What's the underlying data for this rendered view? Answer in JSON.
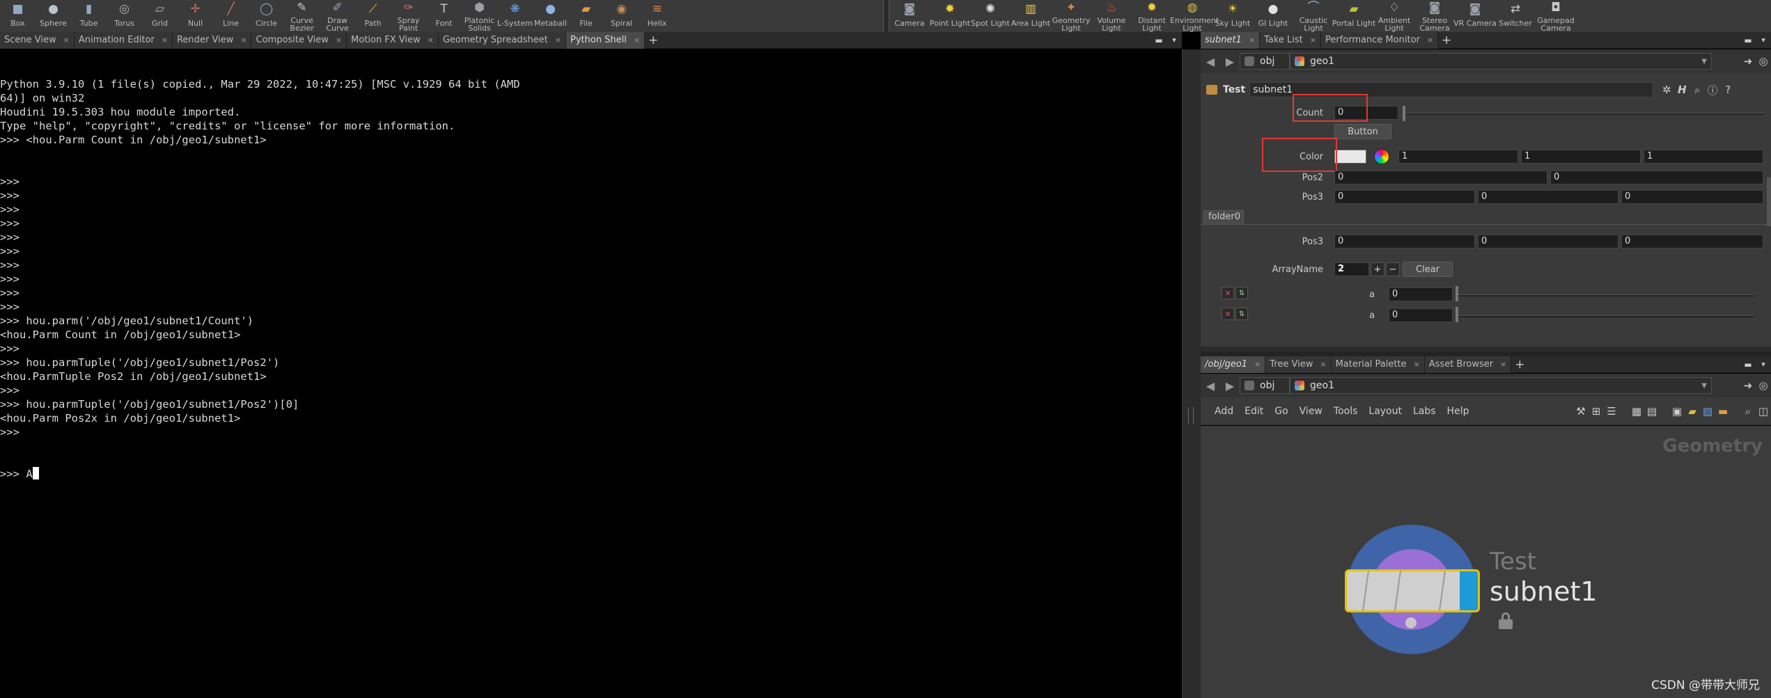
{
  "shelf_left": [
    {
      "label": "Box",
      "icon": "box-icon",
      "glyph": "■",
      "color": "#8fa8c4"
    },
    {
      "label": "Sphere",
      "icon": "sphere-icon",
      "glyph": "●",
      "color": "#b9c4d0"
    },
    {
      "label": "Tube",
      "icon": "tube-icon",
      "glyph": "▮",
      "color": "#8fa8c4"
    },
    {
      "label": "Torus",
      "icon": "torus-icon",
      "glyph": "◎",
      "color": "#a9b6c6"
    },
    {
      "label": "Grid",
      "icon": "grid-icon",
      "glyph": "▱",
      "color": "#a9b6c6"
    },
    {
      "label": "Null",
      "icon": "null-icon",
      "glyph": "✛",
      "color": "#d0705a"
    },
    {
      "label": "Line",
      "icon": "line-icon",
      "glyph": "╱",
      "color": "#d0705a"
    },
    {
      "label": "Circle",
      "icon": "circle-icon",
      "glyph": "◯",
      "color": "#8fa8c4"
    },
    {
      "label": "Curve Bezier",
      "icon": "curve-bezier-icon",
      "glyph": "✎",
      "color": "#c9c9c9"
    },
    {
      "label": "Draw Curve",
      "icon": "draw-curve-icon",
      "glyph": "✐",
      "color": "#8fa8c4"
    },
    {
      "label": "Path",
      "icon": "path-icon",
      "glyph": "⟋",
      "color": "#e0c040"
    },
    {
      "label": "Spray Paint",
      "icon": "spray-paint-icon",
      "glyph": "✑",
      "color": "#d07070"
    },
    {
      "label": "Font",
      "icon": "font-icon",
      "glyph": "T",
      "color": "#c9c9c9"
    },
    {
      "label": "Platonic Solids",
      "icon": "platonic-solids-icon",
      "glyph": "⬢",
      "color": "#9aa0a8"
    },
    {
      "label": "L-System",
      "icon": "l-system-icon",
      "glyph": "❋",
      "color": "#6aa0e0"
    },
    {
      "label": "Metaball",
      "icon": "metaball-icon",
      "glyph": "●",
      "color": "#8fb4e0"
    },
    {
      "label": "File",
      "icon": "file-icon",
      "glyph": "▰",
      "color": "#e0a040"
    },
    {
      "label": "Spiral",
      "icon": "spiral-icon",
      "glyph": "◉",
      "color": "#d08a50"
    },
    {
      "label": "Helix",
      "icon": "helix-icon",
      "glyph": "≋",
      "color": "#d08a50"
    }
  ],
  "shelf_right": [
    {
      "label": "Camera",
      "icon": "camera-icon",
      "glyph": "◙",
      "color": "#9aa0a8"
    },
    {
      "label": "Point Light",
      "icon": "point-light-icon",
      "glyph": "✸",
      "color": "#f0d040"
    },
    {
      "label": "Spot Light",
      "icon": "spot-light-icon",
      "glyph": "✺",
      "color": "#e0e0e0"
    },
    {
      "label": "Area Light",
      "icon": "area-light-icon",
      "glyph": "▥",
      "color": "#f0d040"
    },
    {
      "label": "Geometry Light",
      "icon": "geometry-light-icon",
      "glyph": "✦",
      "color": "#d08a50"
    },
    {
      "label": "Volume Light",
      "icon": "volume-light-icon",
      "glyph": "♨",
      "color": "#e06030"
    },
    {
      "label": "Distant Light",
      "icon": "distant-light-icon",
      "glyph": "✹",
      "color": "#f0d040"
    },
    {
      "label": "Environment Light",
      "icon": "environment-light-icon",
      "glyph": "◍",
      "color": "#e0c040"
    },
    {
      "label": "Sky Light",
      "icon": "sky-light-icon",
      "glyph": "☀",
      "color": "#f0d040"
    },
    {
      "label": "GI Light",
      "icon": "gi-light-icon",
      "glyph": "●",
      "color": "#e0e0e0"
    },
    {
      "label": "Caustic Light",
      "icon": "caustic-light-icon",
      "glyph": "⌒",
      "color": "#8fb4e0"
    },
    {
      "label": "Portal Light",
      "icon": "portal-light-icon",
      "glyph": "▰",
      "color": "#c0c040"
    },
    {
      "label": "Ambient Light",
      "icon": "ambient-light-icon",
      "glyph": "♢",
      "color": "#e0e0e0"
    },
    {
      "label": "Stereo Camera",
      "icon": "stereo-camera-icon",
      "glyph": "◙",
      "color": "#9aa0a8"
    },
    {
      "label": "VR Camera",
      "icon": "vr-camera-icon",
      "glyph": "◙",
      "color": "#9aa0a8"
    },
    {
      "label": "Switcher",
      "icon": "switcher-icon",
      "glyph": "⇄",
      "color": "#c9c9c9"
    },
    {
      "label": "Gamepad Camera",
      "icon": "gamepad-camera-icon",
      "glyph": "◘",
      "color": "#c9c9c9"
    }
  ],
  "left_tabs": [
    {
      "label": "Scene View",
      "active": false
    },
    {
      "label": "Animation Editor",
      "active": false
    },
    {
      "label": "Render View",
      "active": false
    },
    {
      "label": "Composite View",
      "active": false
    },
    {
      "label": "Motion FX View",
      "active": false
    },
    {
      "label": "Geometry Spreadsheet",
      "active": false
    },
    {
      "label": "Python Shell",
      "active": true
    }
  ],
  "console_lines": [
    "Python 3.9.10 (1 file(s) copied., Mar 29 2022, 10:47:25) [MSC v.1929 64 bit (AMD",
    "64)] on win32",
    "Houdini 19.5.303 hou module imported.",
    "Type \"help\", \"copyright\", \"credits\" or \"license\" for more information.",
    ">>> <hou.Parm Count in /obj/geo1/subnet1>",
    "",
    "",
    ">>>",
    ">>>",
    ">>>",
    ">>>",
    ">>>",
    ">>>",
    ">>>",
    ">>>",
    ">>>",
    ">>>",
    ">>> hou.parm('/obj/geo1/subnet1/Count')",
    "<hou.Parm Count in /obj/geo1/subnet1>",
    ">>>",
    ">>> hou.parmTuple('/obj/geo1/subnet1/Pos2')",
    "<hou.ParmTuple Pos2 in /obj/geo1/subnet1>",
    ">>>",
    ">>> hou.parmTuple('/obj/geo1/subnet1/Pos2')[0]",
    "<hou.Parm Pos2x in /obj/geo1/subnet1>",
    ">>>"
  ],
  "console_prompt": ">>> A",
  "param_tabs": [
    {
      "label": "subnet1",
      "active": true,
      "italic": true
    },
    {
      "label": "Take List",
      "active": false,
      "italic": false
    },
    {
      "label": "Performance Monitor",
      "active": false,
      "italic": false
    }
  ],
  "param_path": {
    "context": "obj",
    "node": "geo1"
  },
  "param_header": {
    "type": "Test",
    "name": "subnet1"
  },
  "params": {
    "count_label": "Count",
    "count_value": "0",
    "button_label": "Button",
    "color_label": "Color",
    "color_r": "1",
    "color_g": "1",
    "color_b": "1",
    "pos2_label": "Pos2",
    "pos2_x": "0",
    "pos2_y": "0",
    "pos3_label": "Pos3",
    "pos3_x": "0",
    "pos3_y": "0",
    "pos3_z": "0",
    "folder_label": "folder0",
    "pos3b_label": "Pos3",
    "pos3b_x": "0",
    "pos3b_y": "0",
    "pos3b_z": "0",
    "array_label": "ArrayName",
    "array_value": "2",
    "clear_label": "Clear",
    "a1_label": "a",
    "a1_value": "0",
    "a2_label": "a",
    "a2_value": "0"
  },
  "net_tabs": [
    {
      "label": "/obj/geo1",
      "active": true,
      "italic": true
    },
    {
      "label": "Tree View",
      "active": false,
      "italic": false
    },
    {
      "label": "Material Palette",
      "active": false,
      "italic": false
    },
    {
      "label": "Asset Browser",
      "active": false,
      "italic": false
    }
  ],
  "net_path": {
    "context": "obj",
    "node": "geo1"
  },
  "net_menu": [
    "Add",
    "Edit",
    "Go",
    "View",
    "Tools",
    "Layout",
    "Labs",
    "Help"
  ],
  "net_context_label": "Geometry",
  "node": {
    "type": "Test",
    "name": "subnet1"
  },
  "watermark": "CSDN @带带大师兄",
  "colors": {
    "accent_red": "#e53935",
    "node_ring": "#3f64a8",
    "node_inner": "#9a6fd6",
    "node_select": "#e6c000",
    "node_flag": "#1e9bd7"
  }
}
